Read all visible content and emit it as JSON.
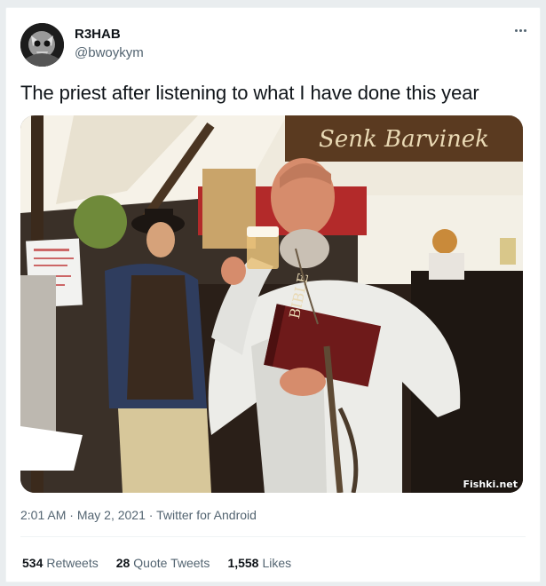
{
  "author": {
    "display_name": "R3HAB",
    "handle": "@bwoykym",
    "avatar_icon": "skull-avatar-icon"
  },
  "more_icon": "more-dots-icon",
  "tweet": {
    "text": "The priest after listening to what I have done this year"
  },
  "media": {
    "alt": "Priest in white robe drinking a beer while holding a Bible",
    "sign_text": "Senk Barvinek",
    "bible_text": "BIBLE",
    "watermark": "Fishki.net"
  },
  "meta": {
    "time": "2:01 AM",
    "date": "May 2, 2021",
    "separator": " · ",
    "source": "Twitter for Android"
  },
  "stats": [
    {
      "count": "534",
      "label": "Retweets"
    },
    {
      "count": "28",
      "label": "Quote Tweets"
    },
    {
      "count": "1,558",
      "label": "Likes"
    }
  ],
  "colors": {
    "text_primary": "#0f1419",
    "text_secondary": "#536471",
    "border": "#eff3f4"
  }
}
